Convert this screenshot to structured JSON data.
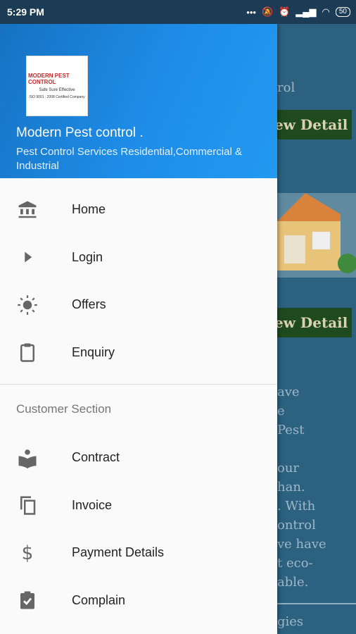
{
  "status_bar": {
    "time": "5:29 PM",
    "battery": "50"
  },
  "drawer": {
    "header": {
      "logo_text": [
        "MODERN PEST CONTROL",
        "Safe  Sure  Effective",
        "ISO 9001 : 2008 Certified Company"
      ],
      "title": "Modern Pest control .",
      "subtitle": "Pest Control Services Residential,Commercial & Industrial"
    },
    "items": [
      {
        "label": "Home",
        "icon": "bank-icon"
      },
      {
        "label": "Login",
        "icon": "play-icon"
      },
      {
        "label": "Offers",
        "icon": "sun-icon"
      },
      {
        "label": "Enquiry",
        "icon": "clipboard-icon"
      }
    ],
    "section_title": "Customer Section",
    "customer_items": [
      {
        "label": "Contract",
        "icon": "reader-icon"
      },
      {
        "label": "Invoice",
        "icon": "copy-icon"
      },
      {
        "label": "Payment Details",
        "icon": "dollar-icon"
      },
      {
        "label": "Complain",
        "icon": "assignment-check-icon"
      }
    ]
  },
  "background": {
    "lines": [
      "rol",
      "ew Detail",
      "ew Detail",
      "ave",
      "e",
      "Pest",
      "our",
      "han.",
      ". With",
      "ontrol",
      "ve have",
      "t eco-",
      "able.",
      "gies"
    ]
  }
}
